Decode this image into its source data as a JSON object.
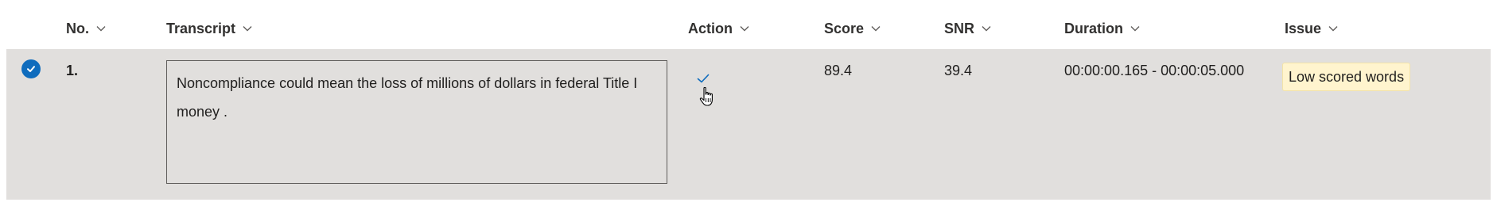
{
  "columns": {
    "no": "No.",
    "transcript": "Transcript",
    "action": "Action",
    "score": "Score",
    "snr": "SNR",
    "duration": "Duration",
    "issue": "Issue"
  },
  "row": {
    "selected": true,
    "number": "1.",
    "transcript": "Noncompliance could mean the loss of millions of dollars in federal Title I money .",
    "action": "approved",
    "score": "89.4",
    "snr": "39.4",
    "duration": "00:00:00.165 - 00:00:05.000",
    "issue": "Low scored words"
  },
  "icons": {
    "sort": "chevron-down-icon",
    "select": "checkmark-circle-icon",
    "action": "checkmark-icon",
    "cursor": "hand-pointer-cursor"
  },
  "colors": {
    "row_background": "#e1dfdd",
    "accent": "#0f6cbd",
    "issue_badge": "#fff4ce"
  }
}
